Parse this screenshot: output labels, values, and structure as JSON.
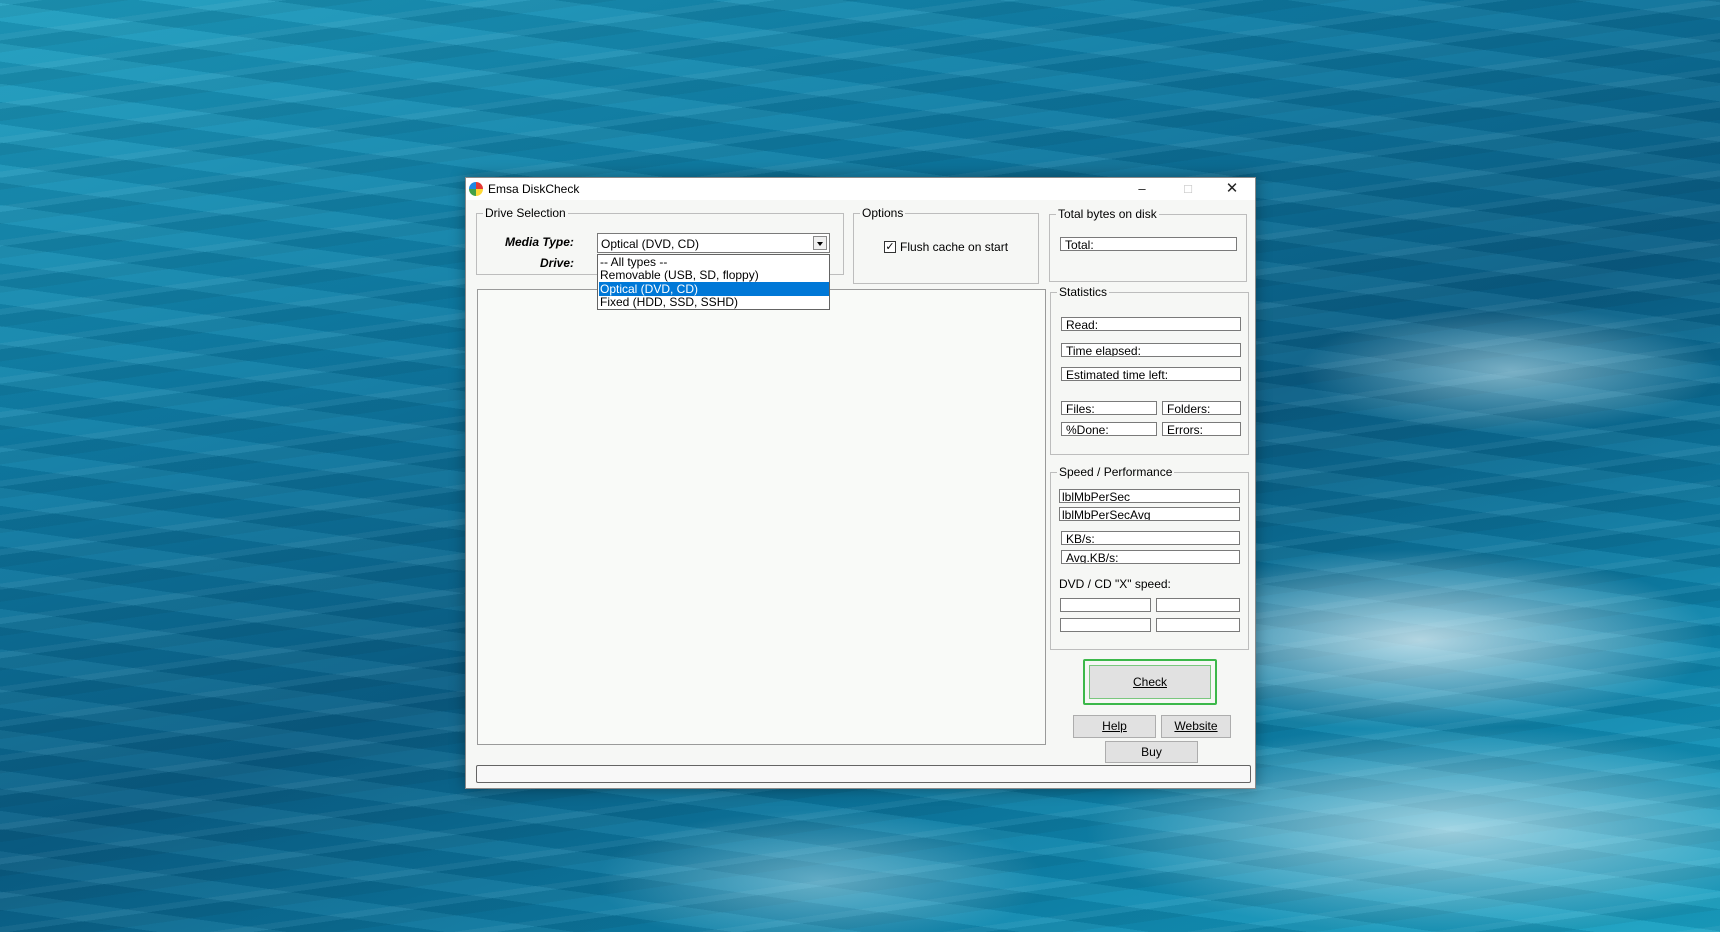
{
  "window": {
    "title": "Emsa DiskCheck"
  },
  "drive_selection": {
    "legend": "Drive Selection",
    "media_type_label": "Media Type:",
    "drive_label": "Drive:",
    "media_type_value": "Optical (DVD, CD)",
    "options": [
      "-- All types --",
      "Removable (USB, SD, floppy)",
      "Optical (DVD, CD)",
      "Fixed (HDD, SSD, SSHD)"
    ],
    "selected_index": 2
  },
  "options_group": {
    "legend": "Options",
    "flush_cache_label": "Flush cache on start",
    "flush_cache_checked": true
  },
  "total_bytes": {
    "legend": "Total bytes on disk",
    "total_label": "Total:"
  },
  "statistics": {
    "legend": "Statistics",
    "read": "Read:",
    "time_elapsed": "Time elapsed:",
    "estimated_time_left": "Estimated time left:",
    "files": "Files:",
    "folders": "Folders:",
    "percent_done": "%Done:",
    "errors": "Errors:"
  },
  "speed": {
    "legend": "Speed / Performance",
    "mb_per_sec": "lblMbPerSec",
    "mb_per_sec_avg": "lblMbPerSecAvg",
    "kbs": "KB/s:",
    "avg_kbs": "Avg.KB/s:",
    "dvd_speed_label": "DVD / CD \"X\" speed:"
  },
  "buttons": {
    "check": "Check",
    "help": "Help",
    "website": "Website",
    "buy": "Buy"
  },
  "icons": {
    "app": "emsa-diskcheck-icon",
    "minimize": "minimize-icon",
    "maximize": "maximize-icon",
    "close": "close-icon",
    "dropdown": "chevron-down-icon"
  }
}
